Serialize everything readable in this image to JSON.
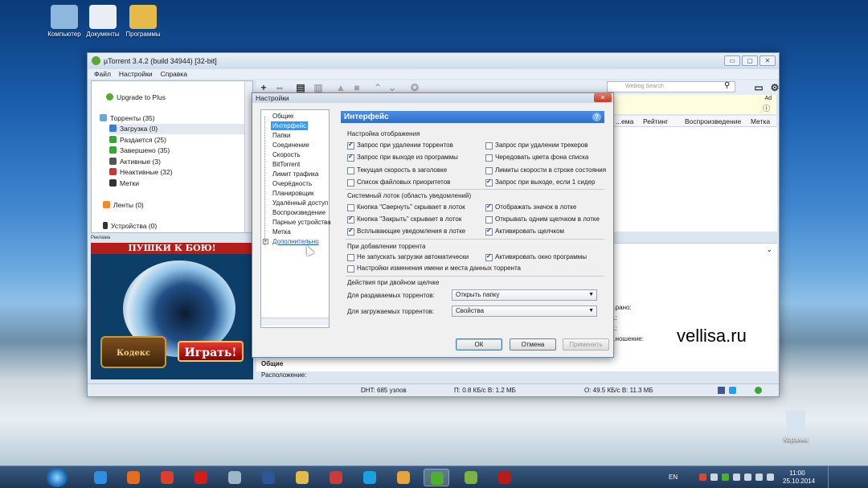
{
  "desktop": {
    "icons": [
      {
        "label": "Компьютер",
        "color": "#8fb7de"
      },
      {
        "label": "Документы",
        "color": "#e9eef5"
      },
      {
        "label": "Программы",
        "color": "#e6b94b"
      }
    ],
    "recycle_bin": "Корзина"
  },
  "window": {
    "title": "µTorrent 3.4.2 (build 34944) [32-bit]",
    "menu": [
      "Файл",
      "Настройки",
      "Справка"
    ],
    "controls": [
      "▭",
      "▢",
      "✕"
    ]
  },
  "sidebar": {
    "upgrade": "Upgrade to Plus",
    "torrents": "Торренты (35)",
    "items": [
      {
        "label": "Загрузка (0)",
        "color": "#3a7cd0"
      },
      {
        "label": "Раздается (25)",
        "color": "#3aa33a"
      },
      {
        "label": "Завершено (35)",
        "color": "#3aa33a"
      },
      {
        "label": "Активные (3)",
        "color": "#555555"
      },
      {
        "label": "Неактивные (32)",
        "color": "#c23a3a"
      }
    ],
    "labels": "Метки",
    "feeds": "Ленты (0)",
    "devices": "Устройства (0)"
  },
  "ad": {
    "label": "Реклама",
    "headline": "ПУШКИ К БОЮ!",
    "logo": "Кодекс ПИРАТА",
    "play_button": "Играть!"
  },
  "search": {
    "placeholder": "Weblog Search"
  },
  "adbar": {
    "ad": "Ad"
  },
  "columns": [
    "...ема",
    "Рейтинг",
    "Воспроизведение",
    "Метка"
  ],
  "details": {
    "section": "Общие",
    "location_label": "Расположение:",
    "partial_lines": [
      "...рано:",
      "...:",
      "...:",
      "...ношение:"
    ]
  },
  "statusbar": {
    "dht": "DHT: 685 узлов",
    "download": "П: 0.8 КБ/с В: 1.2 МБ",
    "upload": "О: 49.5 КБ/с В: 11.3 МБ"
  },
  "settings": {
    "title": "Настройки",
    "close": "✕",
    "nav": [
      "Общие",
      "Интерфейс",
      "Папки",
      "Соединение",
      "Скорость",
      "BitTorrent",
      "Лимит трафика",
      "Очерёдность",
      "Планировщик",
      "Удалённый доступ",
      "Воспроизведение",
      "Парные устройства",
      "Метка",
      "Дополнительно"
    ],
    "selected_nav": "Интерфейс",
    "panel_title": "Интерфейс",
    "help": "?",
    "display_group": "Настройка отображения",
    "display_left": [
      {
        "label": "Запрос при удалении торрентов",
        "checked": true
      },
      {
        "label": "Запрос при выходе из программы",
        "checked": true
      },
      {
        "label": "Текущая скорость в заголовке",
        "checked": false
      },
      {
        "label": "Список файловых приоритетов",
        "checked": false
      }
    ],
    "display_right": [
      {
        "label": "Запрос при удалении трекеров",
        "checked": false
      },
      {
        "label": "Чередовать цвета фона списка",
        "checked": false
      },
      {
        "label": "Лимиты скорости в строке состояния",
        "checked": false
      },
      {
        "label": "Запрос при выходе, если 1 сидер",
        "checked": true
      }
    ],
    "tray_group": "Системный лоток (область уведомлений)",
    "tray_left": [
      {
        "label": "Кнопка \"Свернуть\" скрывает в лоток",
        "checked": false
      },
      {
        "label": "Кнопка \"Закрыть\" скрывает в лоток",
        "checked": true
      },
      {
        "label": "Всплывающие уведомления в лотке",
        "checked": true
      }
    ],
    "tray_right": [
      {
        "label": "Отображать значок в лотке",
        "checked": true
      },
      {
        "label": "Открывать одним щелчком в лотке",
        "checked": false
      },
      {
        "label": "Активировать щелчком",
        "checked": true
      }
    ],
    "add_group": "При добавлении торрента",
    "add_items": [
      {
        "label": "Не запускать загрузки автоматически",
        "checked": false
      },
      {
        "label": "Активировать окно программы",
        "checked": true
      },
      {
        "label": "Настройки изменения имени и места данных торрента",
        "checked": false
      }
    ],
    "dblclick_group": "Действия при двойном щелчке",
    "seeding_label": "Для раздаваемых торрентов:",
    "seeding_value": "Открыть папку",
    "downloading_label": "Для загружаемых торрентов:",
    "downloading_value": "Свойства",
    "ok": "ОК",
    "cancel": "Отмена",
    "apply": "Применить"
  },
  "watermark": "vellisa.ru",
  "taskbar": {
    "apps": [
      {
        "name": "ie",
        "color": "#2e8ee0"
      },
      {
        "name": "firefox",
        "color": "#e56b1f"
      },
      {
        "name": "chrome",
        "color": "#d9402f"
      },
      {
        "name": "opera",
        "color": "#d21d1d"
      },
      {
        "name": "app5",
        "color": "#9fb6c9"
      },
      {
        "name": "word",
        "color": "#2b5797"
      },
      {
        "name": "explorer",
        "color": "#e5b84a"
      },
      {
        "name": "picasa",
        "color": "#c93c3c"
      },
      {
        "name": "skype",
        "color": "#1ba1e2"
      },
      {
        "name": "player",
        "color": "#e8a33d"
      },
      {
        "name": "utorrent",
        "color": "#4caf32"
      },
      {
        "name": "app12",
        "color": "#7cb342"
      },
      {
        "name": "app13",
        "color": "#b71c1c"
      }
    ],
    "lang": "EN",
    "time": "11:00",
    "date": "25.10.2014"
  }
}
